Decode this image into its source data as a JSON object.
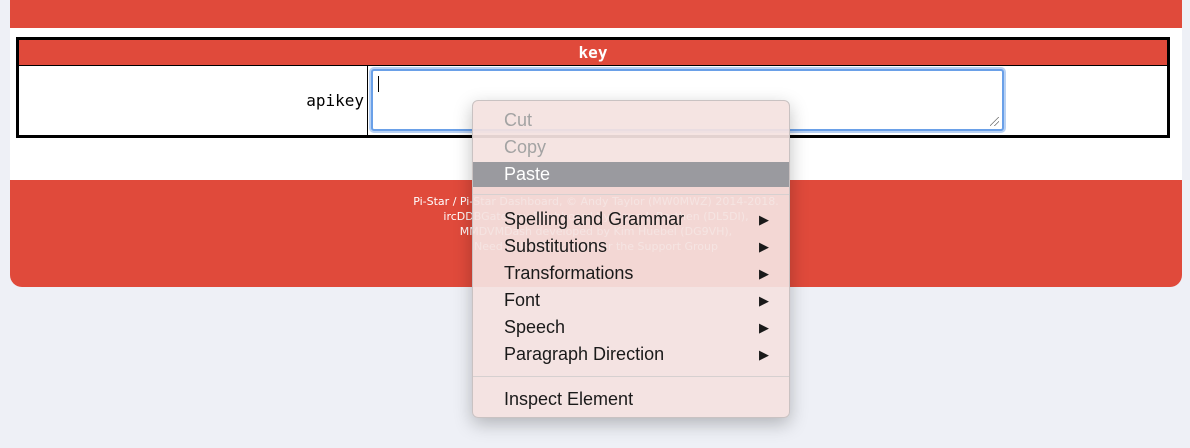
{
  "config": {
    "section_title": "key",
    "field_label": "apikey",
    "field_value": ""
  },
  "footer": {
    "line1": "Pi-Star / Pi-Star Dashboard, © Andy Taylor (MW0MWZ) 2014-2018.",
    "line2": "ircDDBGateway Dashboard by Hans-J. Barthen (DL5DI),",
    "line3": "MMDVMDash developed by Kim Huebel (DG9VH),",
    "line4": "Need help? Click here for the Support Group"
  },
  "context_menu": {
    "cut": "Cut",
    "copy": "Copy",
    "paste": "Paste",
    "spelling": "Spelling and Grammar",
    "substitutions": "Substitutions",
    "transformations": "Transformations",
    "font": "Font",
    "speech": "Speech",
    "paragraph_direction": "Paragraph Direction",
    "inspect": "Inspect Element",
    "submenu_arrow": "▶"
  },
  "colors": {
    "accent_red": "#e04a3b",
    "page_bg": "#eef0f6",
    "highlight": "#9a9a9f"
  }
}
